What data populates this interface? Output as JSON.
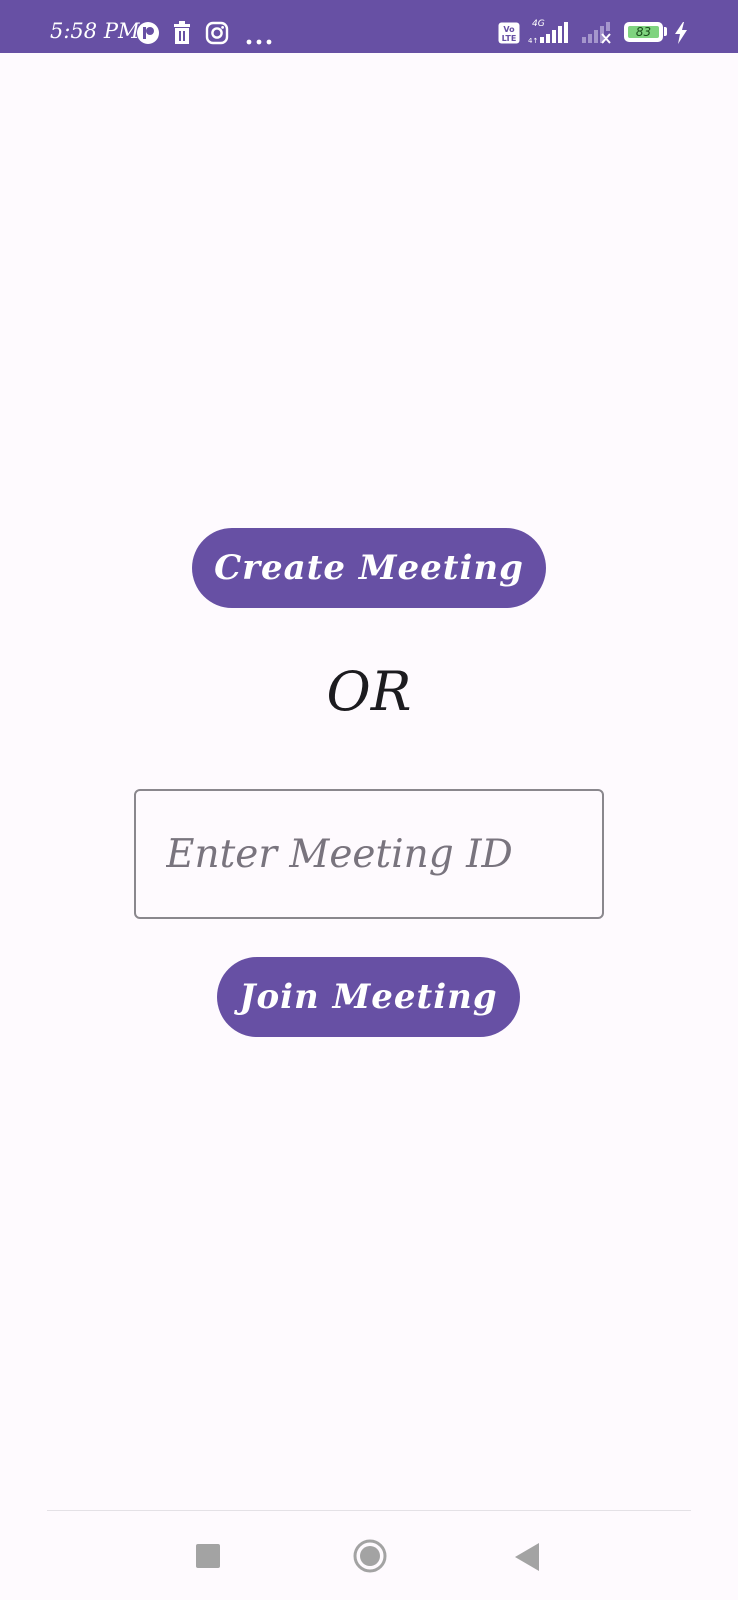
{
  "status_bar": {
    "time": "5:58 PM",
    "network_label_top": "4G",
    "volte_label": "Vo LTE",
    "battery_level": "83",
    "background_color": "#6750a4",
    "icons": [
      "app-notification-icon",
      "trash-icon",
      "instagram-icon",
      "more-dots-icon",
      "volte-icon",
      "signal-icon",
      "signal-no-service-icon",
      "battery-icon",
      "charging-icon"
    ]
  },
  "main": {
    "create_button_label": "Create Meeting",
    "or_label": "OR",
    "meeting_id_input": {
      "value": "",
      "placeholder": "Enter Meeting ID"
    },
    "join_button_label": "Join Meeting",
    "accent_color": "#6750a4"
  },
  "nav_bar": {
    "icons": [
      "recents-square-icon",
      "home-circle-icon",
      "back-triangle-icon"
    ]
  }
}
